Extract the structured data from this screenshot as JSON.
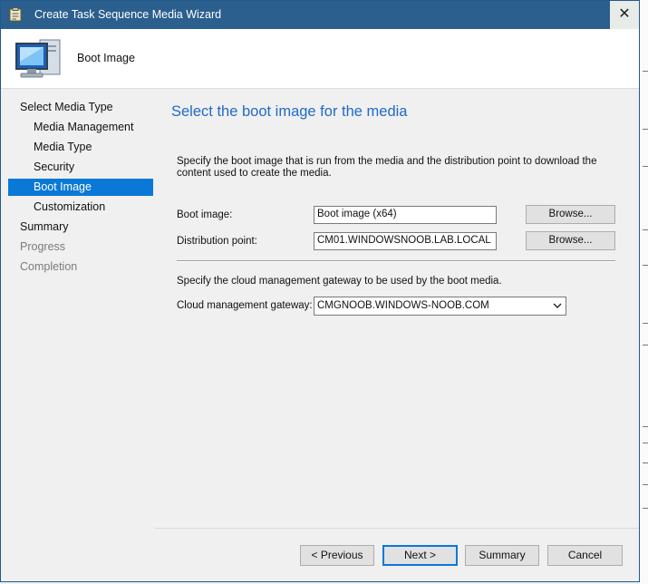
{
  "window": {
    "title": "Create Task Sequence Media Wizard",
    "close_glyph": "✕",
    "app_icon": "wizard-clipboard-icon",
    "header_icon": "computer-monitor-icon",
    "title_bar_color": "#2b5f8e"
  },
  "header": {
    "step_title": "Boot Image"
  },
  "nav": {
    "items": [
      {
        "label": "Select Media Type",
        "level": 0,
        "state": "normal"
      },
      {
        "label": "Media Management",
        "level": 1,
        "state": "normal"
      },
      {
        "label": "Media Type",
        "level": 1,
        "state": "normal"
      },
      {
        "label": "Security",
        "level": 1,
        "state": "normal"
      },
      {
        "label": "Boot Image",
        "level": 1,
        "state": "selected"
      },
      {
        "label": "Customization",
        "level": 1,
        "state": "normal"
      },
      {
        "label": "Summary",
        "level": 0,
        "state": "normal"
      },
      {
        "label": "Progress",
        "level": 0,
        "state": "disabled"
      },
      {
        "label": "Completion",
        "level": 0,
        "state": "disabled"
      }
    ]
  },
  "content": {
    "title": "Select the boot image for the media",
    "description": "Specify the boot image that is run from the media and the distribution point to download the content used to create the media.",
    "boot_image": {
      "label": "Boot image:",
      "value": "Boot image (x64)",
      "browse_label": "Browse..."
    },
    "distribution_point": {
      "label": "Distribution point:",
      "value": "CM01.WINDOWSNOOB.LAB.LOCAL",
      "browse_label": "Browse..."
    },
    "cmg_description": "Specify the cloud management gateway to be used by the boot media.",
    "cmg": {
      "label": "Cloud management gateway:",
      "value": "CMGNOOB.WINDOWS-NOOB.COM"
    }
  },
  "footer": {
    "previous": "< Previous",
    "next": "Next >",
    "summary": "Summary",
    "cancel": "Cancel"
  },
  "colors": {
    "accent": "#0a78d7",
    "title_text": "#1f6ac8"
  }
}
